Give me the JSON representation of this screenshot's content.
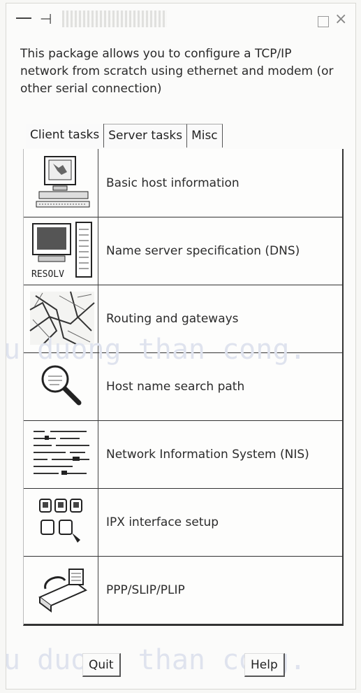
{
  "intro_text": "This package allows you to configure a TCP/IP network from scratch using ethernet and modem (or other serial connection)",
  "tabs": [
    {
      "label": "Client tasks"
    },
    {
      "label": "Server tasks"
    },
    {
      "label": "Misc"
    }
  ],
  "rows": [
    {
      "label": "Basic host information",
      "icon": "computer-icon"
    },
    {
      "label": "Name server specification (DNS)",
      "icon": "resolv-server-icon",
      "icon_text": "RESOLV"
    },
    {
      "label": "Routing and gateways",
      "icon": "map-icon"
    },
    {
      "label": "Host name search path",
      "icon": "magnifier-icon"
    },
    {
      "label": "Network Information System (NIS)",
      "icon": "document-list-icon"
    },
    {
      "label": "IPX interface setup",
      "icon": "ipx-nodes-icon"
    },
    {
      "label": "PPP/SLIP/PLIP",
      "icon": "modem-phone-icon"
    }
  ],
  "buttons": {
    "quit": "Quit",
    "help": "Help"
  },
  "watermark": "u duong than cong."
}
